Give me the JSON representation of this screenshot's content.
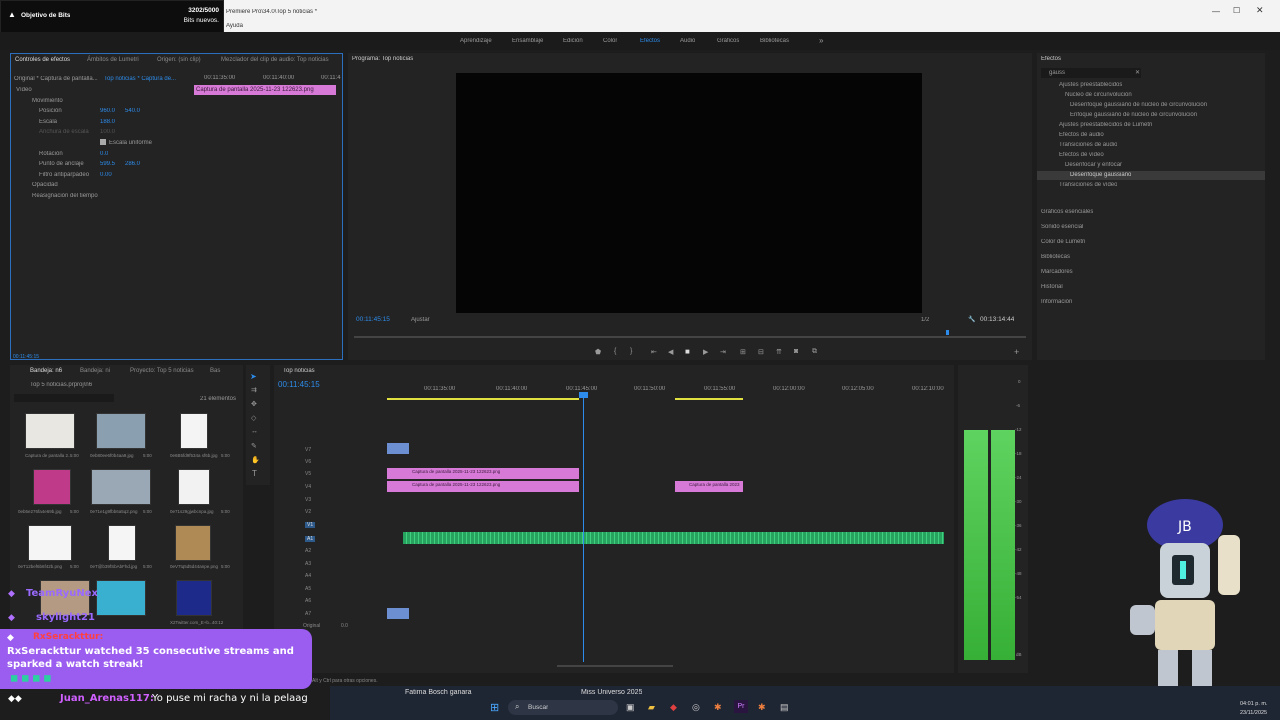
{
  "titlebar": {
    "title": "Premiere Pro\\34.0\\Top 5 noticias *",
    "menu_help": "Ayuda"
  },
  "overlay_goal": {
    "title": "Objetivo de Bits",
    "count": "3202/5000",
    "sub": "Bits nuevos."
  },
  "workspaces": [
    "Aprendizaje",
    "Ensamblaje",
    "Edición",
    "Color",
    "Efectos",
    "Audio",
    "Gráficos",
    "Bibliotecas"
  ],
  "active_workspace": "Efectos",
  "effect_controls": {
    "tabs": [
      "Controles de efectos",
      "Ámbitos de Lumetri",
      "Origen: (sin clip)",
      "Mezclador del clip de audio: Top noticias"
    ],
    "source": "Original * Captura de pantalla...",
    "seq": "Top noticias * Captura de...",
    "ruler": [
      "00:11:35:00",
      "00:11:40:00",
      "00:11:4"
    ],
    "clip_label": "Captura de pantalla 2025-11-23 122623.png",
    "video_label": "Vídeo",
    "rows": [
      {
        "name": "Movimiento",
        "v1": "",
        "v2": ""
      },
      {
        "name": "Posición",
        "v1": "960.0",
        "v2": "540.0"
      },
      {
        "name": "Escala",
        "v1": "188.0",
        "v2": ""
      },
      {
        "name": "Anchura de escala",
        "v1": "100.0",
        "v2": ""
      },
      {
        "name": "Escala uniforme",
        "v1": "",
        "v2": ""
      },
      {
        "name": "Rotación",
        "v1": "0.0",
        "v2": ""
      },
      {
        "name": "Punto de anclaje",
        "v1": "599.5",
        "v2": "286.0"
      },
      {
        "name": "Filtro antiparpadeo",
        "v1": "0.00",
        "v2": ""
      },
      {
        "name": "Opacidad",
        "v1": "",
        "v2": ""
      },
      {
        "name": "Reasignación del tiempo",
        "v1": "",
        "v2": ""
      }
    ],
    "timecode": "00:11:45:15"
  },
  "program": {
    "tab": "Programa: Top noticias",
    "timecode": "00:11:45:15",
    "fit": "Ajustar",
    "res": "1/2",
    "duration": "00:13:14:44"
  },
  "effects_panel": {
    "title": "Efectos",
    "search": "gauss",
    "tree": [
      "Ajustes preestablecidos",
      "Núcleo de circunvolución",
      "Desenfoque gaussiano de núcleo de circunvolución",
      "Enfoque gaussiano de núcleo de circunvolución",
      "Ajustes preestablecidos de Lumetri",
      "Efectos de audio",
      "Transiciones de audio",
      "Efectos de vídeo",
      "Desenfocar y enfocar",
      "Desenfoque gaussiano",
      "Transiciones de vídeo"
    ],
    "sections": [
      "Gráficos esenciales",
      "Sonido esencial",
      "Color de Lumetri",
      "Bibliotecas",
      "Marcadores",
      "Historial",
      "Información"
    ]
  },
  "project": {
    "tabs": [
      "Bandeja: n6",
      "Bandeja: ni",
      "Proyecto: Top 5 noticias",
      "Bas"
    ],
    "path": "Top 5 noticias.prproj\\n6",
    "count": "21 elementos",
    "items": [
      {
        "name": "Captura de pantalla 2...",
        "dur": "5:00"
      },
      {
        "name": "0eb80ee6f0b4aa9.jpg",
        "dur": "5:00"
      },
      {
        "name": "0e6B5fd9f534a sf6b.jpg",
        "dur": "5:00"
      },
      {
        "name": "0eb5e276fa4e69b.jpg",
        "dur": "5:00"
      },
      {
        "name": "0e71e1g9fbb6a5q2.png",
        "dur": "5:00"
      },
      {
        "name": "0e71s29gjwbcnpa.jpg",
        "dur": "5:00"
      },
      {
        "name": "0eT12bef6b6f42b.png",
        "dur": "5:00"
      },
      {
        "name": "0eT@b39fSbAbFhd.jpg",
        "dur": "5:00"
      },
      {
        "name": "0eV7tq5d5d44anpe.png",
        "dur": "5:00"
      },
      {
        "name": "",
        "dur": ""
      },
      {
        "name": "",
        "dur": ""
      },
      {
        "name": "X2Twitter.com_E+b...",
        "dur": "40:12"
      }
    ]
  },
  "timeline": {
    "tab": "Top noticias",
    "timecode": "00:11:45:15",
    "ruler": [
      "00:11:35:00",
      "00:11:40:00",
      "00:11:45:00",
      "00:11:50:00",
      "00:11:55:00",
      "00:12:00:00",
      "00:12:05:00",
      "00:12:10:00"
    ],
    "video_tracks": [
      "V7",
      "V6",
      "V5",
      "V4",
      "V3",
      "V2",
      "V1"
    ],
    "audio_tracks": [
      "A1",
      "A2",
      "A3",
      "A4",
      "A5",
      "A6",
      "A7"
    ],
    "clips": [
      "Captura de pantalla 2025-11-23 122623.png",
      "Captura de pantalla 2025-11-23 122623.png",
      "Captura de pantalla 2023"
    ],
    "master_label": "Original",
    "master_val": "0.0",
    "vu_scale": [
      "0",
      "-6",
      "-12",
      "-18",
      "-24",
      "-30",
      "-36",
      "-42",
      "-48",
      "-54",
      "dB"
    ],
    "status": "Alt y Ctrl para otras opciones."
  },
  "chat": {
    "names": [
      "TeamRyuNex",
      "skylight21"
    ],
    "alert_user": "RxSerackttur:",
    "alert_text": "RxSerackttur watched 35 consecutive streams and sparked a watch streak!",
    "line_user": "Juan_Arenas117:",
    "line_text": "Yo puse mi racha y ni la pelaag"
  },
  "taskbar": {
    "search": "Buscar",
    "news1": "Fatima Bosch ganara",
    "news2": "Miss Universo 2025",
    "time": "04:01 p. m.",
    "date": "23/11/2025"
  }
}
